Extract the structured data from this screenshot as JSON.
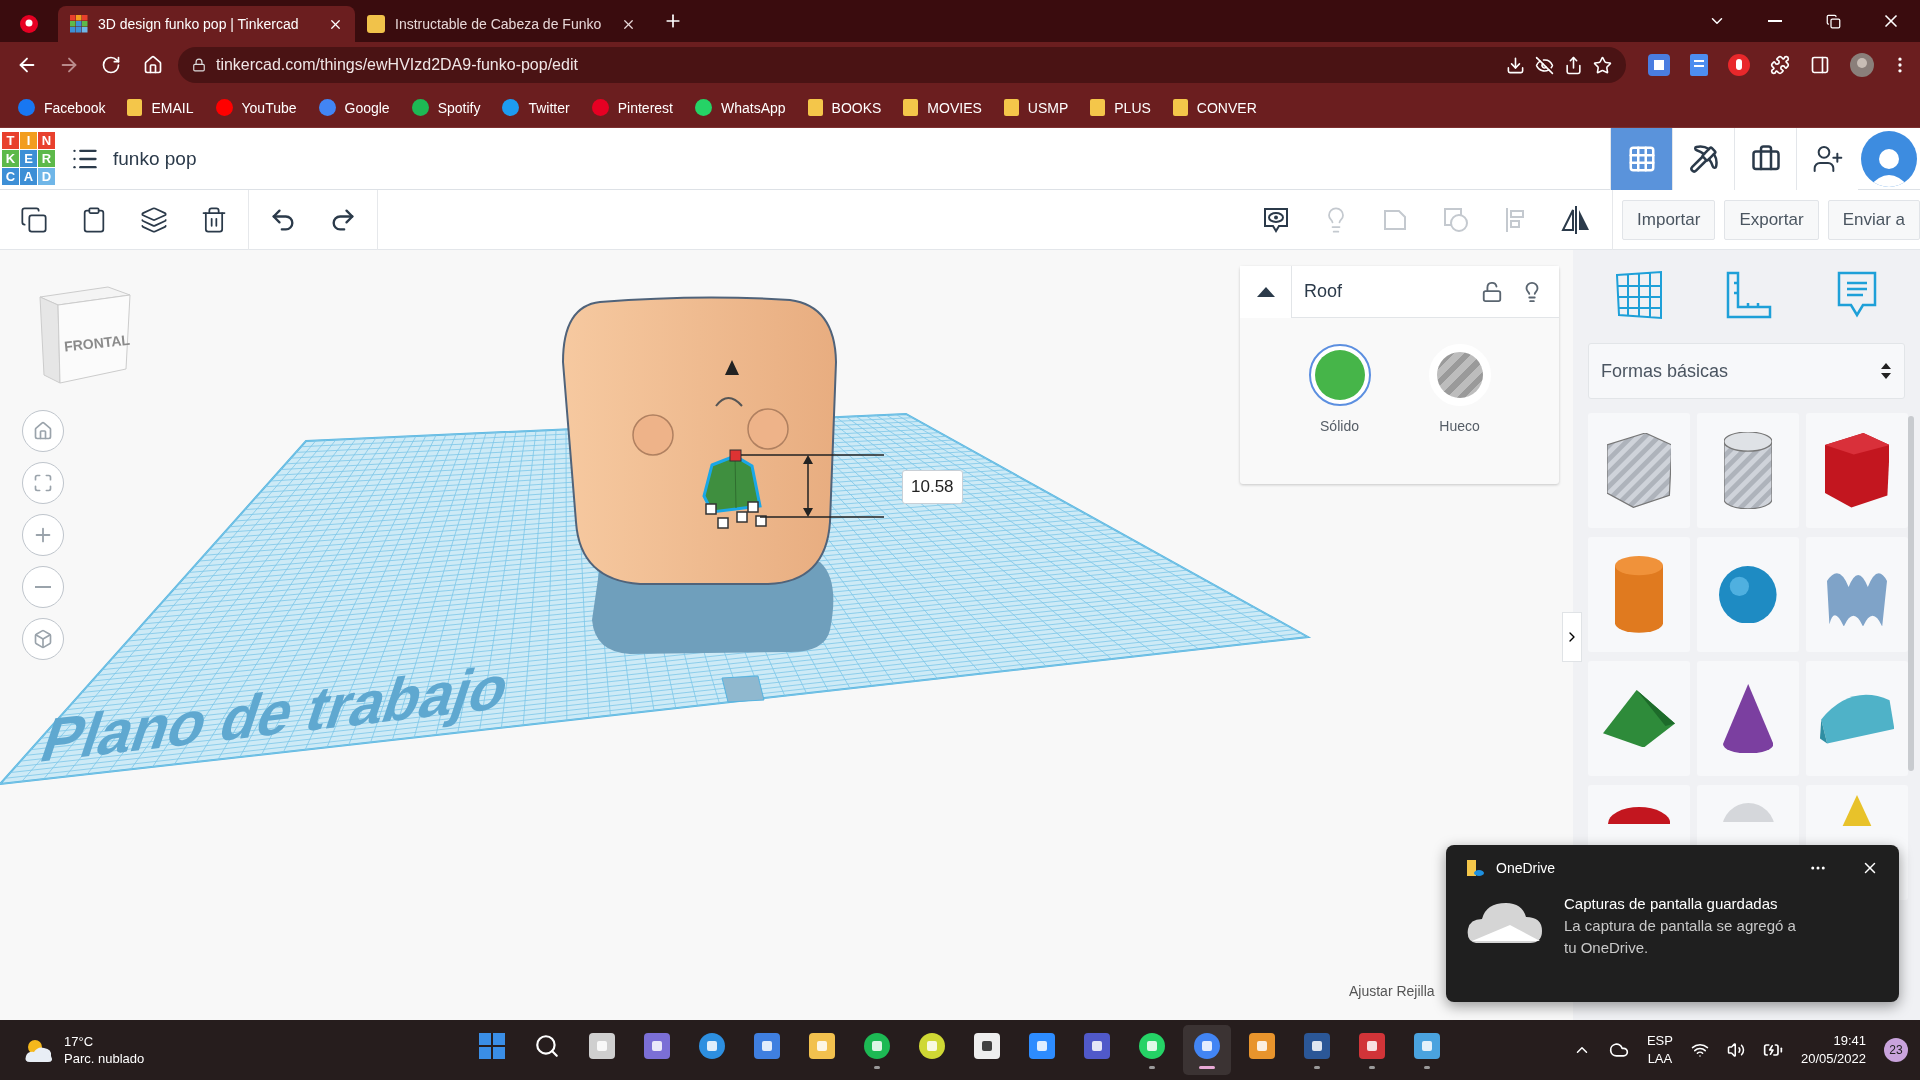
{
  "browser": {
    "tabs": [
      {
        "kind": "pinned",
        "selected": false
      },
      {
        "kind": "page",
        "title": "3D design funko pop | Tinkercad",
        "selected": true
      },
      {
        "kind": "page",
        "title": "Instructable de Cabeza de Funko",
        "selected": false
      }
    ],
    "url": "tinkercad.com/things/ewHVIzd2DA9-funko-pop/edit",
    "bookmarks": [
      {
        "label": "Facebook",
        "kind": "site",
        "color": "#1877f2"
      },
      {
        "label": "EMAIL",
        "kind": "folder"
      },
      {
        "label": "YouTube",
        "kind": "site",
        "color": "#ff0000"
      },
      {
        "label": "Google",
        "kind": "site",
        "color": "#4285f4"
      },
      {
        "label": "Spotify",
        "kind": "site",
        "color": "#1db954"
      },
      {
        "label": "Twitter",
        "kind": "site",
        "color": "#1d9bf0"
      },
      {
        "label": "Pinterest",
        "kind": "site",
        "color": "#e60023"
      },
      {
        "label": "WhatsApp",
        "kind": "site",
        "color": "#25d366"
      },
      {
        "label": "BOOKS",
        "kind": "folder"
      },
      {
        "label": "MOVIES",
        "kind": "folder"
      },
      {
        "label": "USMP",
        "kind": "folder"
      },
      {
        "label": "PLUS",
        "kind": "folder"
      },
      {
        "label": "CONVER",
        "kind": "folder"
      }
    ]
  },
  "app": {
    "logo": [
      {
        "letter": "T",
        "color": "#e8402d"
      },
      {
        "letter": "I",
        "color": "#f29d1e"
      },
      {
        "letter": "N",
        "color": "#e8402d"
      },
      {
        "letter": "K",
        "color": "#5db94a"
      },
      {
        "letter": "E",
        "color": "#3d8fd6"
      },
      {
        "letter": "R",
        "color": "#5db94a"
      },
      {
        "letter": "C",
        "color": "#3d8fd6"
      },
      {
        "letter": "A",
        "color": "#3d8fd6"
      },
      {
        "letter": "D",
        "color": "#6fb6e8"
      }
    ],
    "project_name": "funko pop",
    "view_modes": [
      {
        "selected": true
      },
      {
        "selected": false
      },
      {
        "selected": false
      }
    ],
    "view_tools": [
      {
        "disabled": false
      },
      {
        "disabled": true
      },
      {
        "disabled": true
      },
      {
        "disabled": true
      },
      {
        "disabled": true
      },
      {
        "disabled": false
      }
    ],
    "buttons": [
      "Importar",
      "Exportar",
      "Enviar a"
    ]
  },
  "viewport": {
    "viewcube_label": "FRONTAL",
    "workplane_label": "Plano de trabajo",
    "dimension": "10.58",
    "snap_grid_label": "Ajustar Rejilla"
  },
  "inspector": {
    "name": "Roof",
    "options": [
      {
        "label": "Sólido",
        "kind": "solid",
        "selected": true
      },
      {
        "label": "Hueco",
        "kind": "hole",
        "selected": false
      }
    ]
  },
  "library": {
    "category": "Formas básicas"
  },
  "notification": {
    "app": "OneDrive",
    "title": "Capturas de pantalla guardadas",
    "body": "La captura de pantalla se agregó a tu OneDrive."
  },
  "taskbar": {
    "temperature": "17°C",
    "weather": "Parc. nublado",
    "apps": [
      {
        "running": false,
        "selected": false
      },
      {
        "running": false,
        "selected": false
      },
      {
        "running": false,
        "selected": false
      },
      {
        "running": false,
        "selected": false
      },
      {
        "running": false,
        "selected": false
      },
      {
        "running": false,
        "selected": false
      },
      {
        "running": false,
        "selected": false
      },
      {
        "running": true,
        "selected": false
      },
      {
        "running": false,
        "selected": false
      },
      {
        "running": false,
        "selected": false
      },
      {
        "running": false,
        "selected": false
      },
      {
        "running": false,
        "selected": false
      },
      {
        "running": true,
        "selected": false
      },
      {
        "running": true,
        "selected": true
      },
      {
        "running": false,
        "selected": false
      },
      {
        "running": true,
        "selected": false
      },
      {
        "running": true,
        "selected": false
      },
      {
        "running": true,
        "selected": false
      }
    ],
    "language": [
      "ESP",
      "LAA"
    ],
    "time": "19:41",
    "date": "20/05/2022",
    "badge": "23"
  }
}
